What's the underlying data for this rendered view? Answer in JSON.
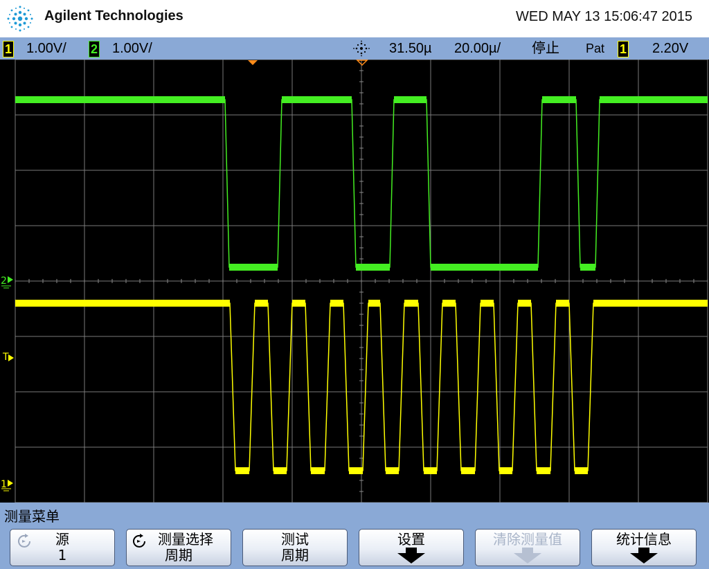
{
  "brand": {
    "name": "Agilent Technologies",
    "logo_icon": "agilent-spark-icon"
  },
  "datetime": "WED MAY 13 15:06:47 2015",
  "status": {
    "ch1_label": "1",
    "ch1_scale": "1.00V/",
    "ch2_label": "2",
    "ch2_scale": "1.00V/",
    "acq_icon": "acquisition-spark-icon",
    "time_delay": "31.50µ",
    "time_scale": "20.00µ/",
    "run_state": "停止",
    "trigger_mode": "Pat",
    "trigger_source": "1",
    "trigger_level": "2.20V"
  },
  "screen": {
    "ch1_marker": "1",
    "ch2_marker": "2",
    "trigger_marker": "T",
    "ch1_color": "#ffff00",
    "ch2_color": "#44ee22"
  },
  "menu": {
    "title": "测量菜单",
    "softkeys": [
      {
        "line1": "源",
        "line2": "1"
      },
      {
        "line1": "测量选择",
        "line2": "周期"
      },
      {
        "line1": "测试",
        "line2": "周期"
      },
      {
        "line1": "设置",
        "line2": ""
      },
      {
        "line1": "清除测量值",
        "line2": ""
      },
      {
        "line1": "统计信息",
        "line2": ""
      }
    ]
  }
}
